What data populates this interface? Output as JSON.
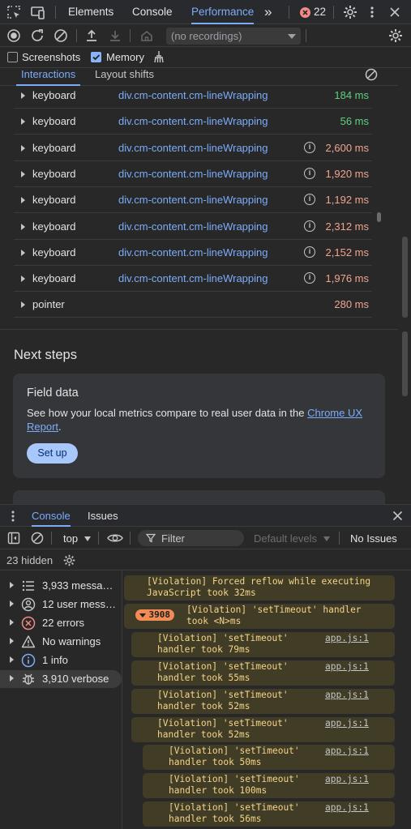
{
  "devtools": {
    "tabs": [
      "Elements",
      "Console",
      "Performance"
    ],
    "more_tabs": "»",
    "error_count": "22"
  },
  "toolbar": {
    "recordings_placeholder": "(no recordings)"
  },
  "options": {
    "screenshots_label": "Screenshots",
    "screenshots_checked": false,
    "memory_label": "Memory",
    "memory_checked": true
  },
  "insights": {
    "tabs": [
      "Interactions",
      "Layout shifts"
    ],
    "interactions": [
      {
        "type": "keyboard",
        "target": "div.cm-content.cm-lineWrapping",
        "duration": "184 ms",
        "status": "good",
        "info": false
      },
      {
        "type": "keyboard",
        "target": "div.cm-content.cm-lineWrapping",
        "duration": "56 ms",
        "status": "good",
        "info": false
      },
      {
        "type": "keyboard",
        "target": "div.cm-content.cm-lineWrapping",
        "duration": "2,600 ms",
        "status": "poor",
        "info": true
      },
      {
        "type": "keyboard",
        "target": "div.cm-content.cm-lineWrapping",
        "duration": "1,920 ms",
        "status": "poor",
        "info": true
      },
      {
        "type": "keyboard",
        "target": "div.cm-content.cm-lineWrapping",
        "duration": "1,192 ms",
        "status": "poor",
        "info": true
      },
      {
        "type": "keyboard",
        "target": "div.cm-content.cm-lineWrapping",
        "duration": "2,312 ms",
        "status": "poor",
        "info": true
      },
      {
        "type": "keyboard",
        "target": "div.cm-content.cm-lineWrapping",
        "duration": "2,152 ms",
        "status": "poor",
        "info": true
      },
      {
        "type": "keyboard",
        "target": "div.cm-content.cm-lineWrapping",
        "duration": "1,976 ms",
        "status": "poor",
        "info": true
      },
      {
        "type": "pointer",
        "target": "",
        "duration": "280 ms",
        "status": "ni",
        "info": false
      }
    ]
  },
  "next_steps": {
    "title": "Next steps",
    "field_data_title": "Field data",
    "field_data_text": "See how your local metrics compare to real user data in the ",
    "field_data_link": "Chrome UX Report",
    "field_data_end": ".",
    "setup_label": "Set up"
  },
  "drawer": {
    "tabs": [
      "Console",
      "Issues"
    ],
    "context": "top",
    "filter_placeholder": "Filter",
    "levels": "Default levels",
    "issues": "No Issues",
    "hidden": "23 hidden"
  },
  "sidebar": {
    "items": [
      {
        "label": "3,933 messa…",
        "icon": "list-icon"
      },
      {
        "label": "12 user mess…",
        "icon": "user-icon"
      },
      {
        "label": "22 errors",
        "icon": "error-icon"
      },
      {
        "label": "No warnings",
        "icon": "warning-icon"
      },
      {
        "label": "1 info",
        "icon": "info-icon"
      },
      {
        "label": "3,910 verbose",
        "icon": "bug-icon"
      }
    ],
    "selected": 5
  },
  "messages": [
    {
      "text": "[Violation] Forced reflow while executing\nJavaScript took 32ms",
      "source": ""
    },
    {
      "text": "[Violation] 'setTimeout' handler\ntook <N>ms",
      "source": "",
      "group_count": "3908"
    },
    {
      "text": "[Violation] 'setTimeout'\nhandler took 79ms",
      "source": "app.js:1"
    },
    {
      "text": "[Violation] 'setTimeout'\nhandler took 55ms",
      "source": "app.js:1"
    },
    {
      "text": "[Violation] 'setTimeout'\nhandler took 52ms",
      "source": "app.js:1"
    },
    {
      "text": "[Violation] 'setTimeout'\nhandler took 52ms",
      "source": "app.js:1"
    },
    {
      "text": "[Violation] 'setTimeout'\nhandler took 50ms",
      "source": "app.js:1"
    },
    {
      "text": "[Violation] 'setTimeout'\nhandler took 100ms",
      "source": "app.js:1"
    },
    {
      "text": "[Violation] 'setTimeout'\nhandler took 56ms",
      "source": "app.js:1"
    }
  ]
}
